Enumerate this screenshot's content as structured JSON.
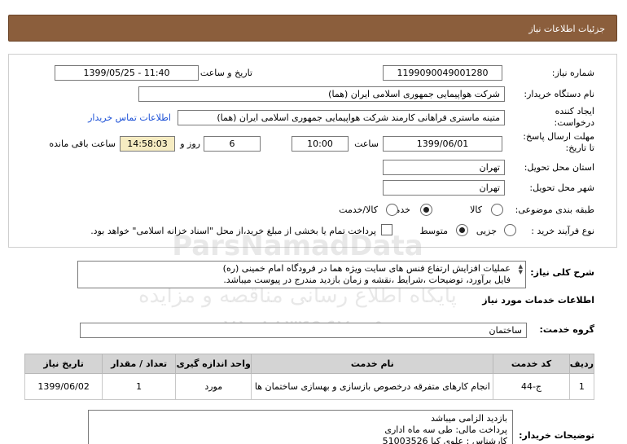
{
  "header": {
    "title": "جزئیات اطلاعات نیاز"
  },
  "form": {
    "need_number_label": "شماره نیاز:",
    "need_number": "1199090049001280",
    "announce_label": "تاریخ و ساعت اعلان عمومی:",
    "announce_value": "1399/05/25 - 11:40",
    "buyer_org_label": "نام دستگاه خریدار:",
    "buyer_org": "شرکت هواپیمایی جمهوری اسلامی ایران (هما)",
    "requester_label_1": "ایجاد کننده",
    "requester_label_2": "درخواست:",
    "requester": "متینه ماستری فراهانی کارمند شرکت هواپیمایی جمهوری اسلامی ایران (هما)",
    "contact_link": "اطلاعات تماس خریدار",
    "deadline_label_1": "مهلت ارسال پاسخ:",
    "deadline_label_2": "تا تاریخ:",
    "deadline_date": "1399/06/01",
    "time_label": "ساعت",
    "deadline_time": "10:00",
    "days_label": "روز و",
    "days_value": "6",
    "remaining_time": "14:58:03",
    "remaining_label": "ساعت باقی مانده",
    "province_label": "استان محل تحویل:",
    "province": "تهران",
    "city_label": "شهر محل تحویل:",
    "city": "تهران",
    "category_label": "طبقه بندی موضوعی:",
    "category_options": [
      "کالا",
      "خدمت",
      "کالا/خدمت"
    ],
    "category_selected": "خدمت",
    "process_label": "نوع فرآیند خرید :",
    "process_options": [
      "جزیی",
      "متوسط"
    ],
    "process_selected": "متوسط",
    "payment_note": "پرداخت تمام یا بخشی از مبلغ خرید،از محل \"اسناد خزانه اسلامی\" خواهد بود."
  },
  "description": {
    "label": "شرح کلی نیاز:",
    "line1": "عملیات افزایش ارتفاع فنس های سایت ویژه هما در فرودگاه امام خمینی (ره)",
    "line2": "فایل برآورد، توضیحات ،شرایط ،نقشه و زمان بازدید مندرج در پیوست میباشد."
  },
  "services": {
    "section_title": "اطلاعات خدمات مورد نیاز",
    "group_label": "گروه خدمت:",
    "group_value": "ساختمان",
    "columns": [
      "ردیف",
      "کد خدمت",
      "نام خدمت",
      "واحد اندازه گیری",
      "تعداد / مقدار",
      "تاریخ نیاز"
    ],
    "rows": [
      {
        "row": "1",
        "code": "ج-44",
        "name": "انجام کارهای متفرقه درخصوص بازسازی و بهسازی ساختمان ها",
        "unit": "مورد",
        "qty": "1",
        "date": "1399/06/02"
      }
    ]
  },
  "notes": {
    "label": "توضیحات خریدار:",
    "line1": "بازدید الزامی میباشد",
    "line2": "پرداخت مالی: طی سه ماه اداری",
    "line3": "کارشناس : علوی کیا 51003526"
  },
  "watermark": {
    "line1": "ParsNamadData",
    "line2": "پایگاه اطلاع رسانی مناقصه و مزایده",
    "line3": "۰۲۱-۸۸۳۴۹۶۷۰-۵"
  }
}
